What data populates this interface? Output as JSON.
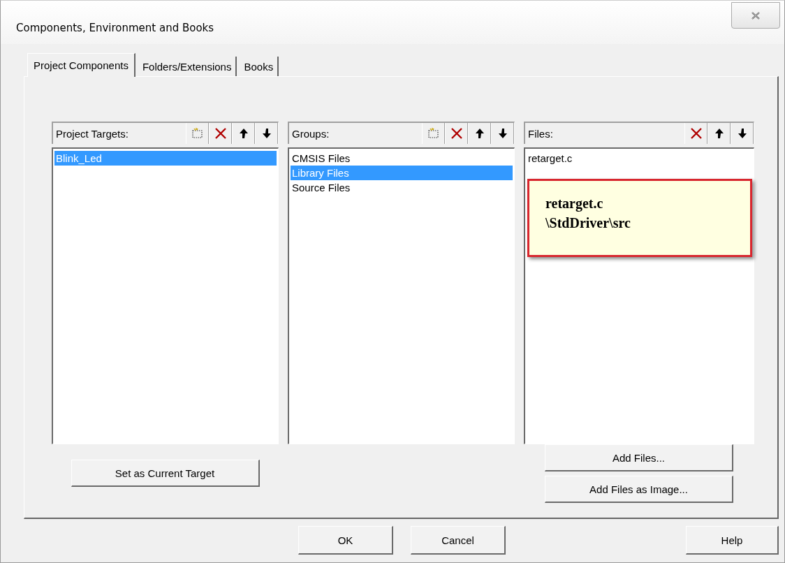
{
  "window": {
    "title": "Components, Environment and Books"
  },
  "tabs": [
    {
      "label": "Project Components",
      "selected": true
    },
    {
      "label": "Folders/Extensions",
      "selected": false
    },
    {
      "label": "Books",
      "selected": false
    }
  ],
  "panels": [
    {
      "title": "Project Targets:",
      "tools": [
        {
          "kind": "new"
        },
        {
          "kind": "delete"
        },
        {
          "kind": "up"
        },
        {
          "kind": "down"
        }
      ],
      "items": [
        {
          "label": "Blink_Led",
          "selected": true
        }
      ],
      "buttons": [
        "Set as Current Target"
      ]
    },
    {
      "title": "Groups:",
      "tools": [
        {
          "kind": "new"
        },
        {
          "kind": "delete"
        },
        {
          "kind": "up"
        },
        {
          "kind": "down"
        }
      ],
      "items": [
        {
          "label": "CMSIS Files",
          "selected": false
        },
        {
          "label": "Library Files",
          "selected": true
        },
        {
          "label": "Source Files",
          "selected": false
        }
      ]
    },
    {
      "title": "Files:",
      "tools": [
        {
          "kind": "delete"
        },
        {
          "kind": "up"
        },
        {
          "kind": "down"
        }
      ],
      "items": [
        {
          "label": "retarget.c",
          "selected": false
        }
      ],
      "tooltip": [
        "retarget.c",
        "\\StdDriver\\src"
      ],
      "buttons": [
        "Add Files...",
        "Add Files as Image..."
      ]
    }
  ],
  "footer_buttons": [
    "OK",
    "Cancel",
    "Help"
  ]
}
